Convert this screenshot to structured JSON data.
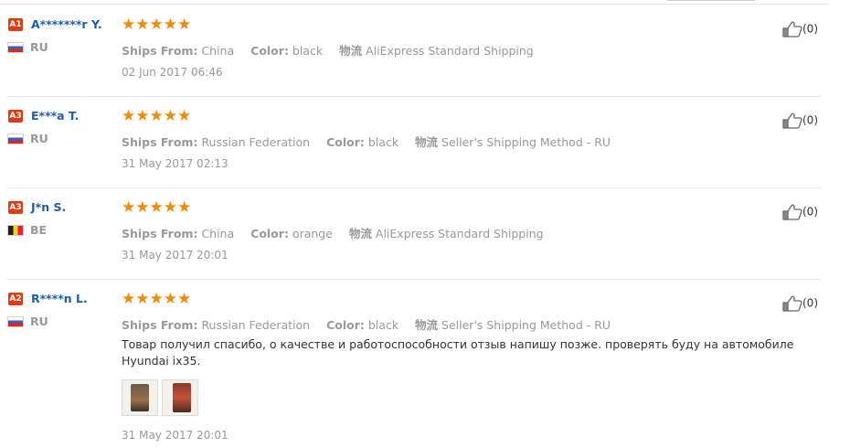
{
  "labels": {
    "ships_from": "Ships From:",
    "color": "Color:",
    "shipping_icon": "物流"
  },
  "reviews": [
    {
      "level": "A1",
      "name": "A*******r Y.",
      "country": "RU",
      "flag": "ru",
      "stars": "★★★★★",
      "ships_from": "China",
      "color": "black",
      "shipping": "AliExpress Standard Shipping",
      "date": "02 Jun 2017 06:46",
      "helpful": "(0)"
    },
    {
      "level": "A3",
      "name": "E***a T.",
      "country": "RU",
      "flag": "ru",
      "stars": "★★★★★",
      "ships_from": "Russian Federation",
      "color": "black",
      "shipping": "Seller's Shipping Method - RU",
      "date": "31 May 2017 02:13",
      "helpful": "(0)"
    },
    {
      "level": "A3",
      "name": "J*n S.",
      "country": "BE",
      "flag": "be",
      "stars": "★★★★★",
      "ships_from": "China",
      "color": "orange",
      "shipping": "AliExpress Standard Shipping",
      "date": "31 May 2017 20:01",
      "helpful": "(0)"
    },
    {
      "level": "A2",
      "name": "R****n L.",
      "country": "RU",
      "flag": "ru",
      "stars": "★★★★★",
      "ships_from": "Russian Federation",
      "color": "black",
      "shipping": "Seller's Shipping Method - RU",
      "comment": "Товар получил спасибо, о качестве и работоспособности отзыв напишу позже. проверять буду на автомобиле Hyundai ix35.",
      "date": "31 May 2017 20:01",
      "helpful": "(0)"
    }
  ],
  "colors": {
    "user_name": "#1c5fa8",
    "badge": "#e33a12",
    "stars": "#f08a08"
  }
}
